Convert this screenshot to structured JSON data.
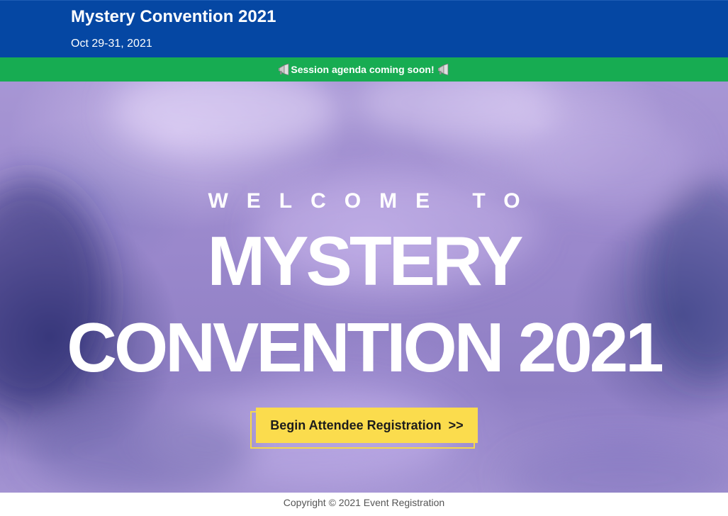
{
  "header": {
    "title": "Mystery Convention 2021",
    "dates": "Oct 29-31, 2021",
    "background_color": "#0547a3"
  },
  "banner": {
    "text": "Session agenda coming soon!",
    "icon": "megaphone-icon",
    "background_color": "#17ac52"
  },
  "hero": {
    "kicker": "WELCOME TO",
    "title_line_1": "MYSTERY",
    "title_line_2": "CONVENTION 2021",
    "cta_label": "Begin Attendee Registration",
    "cta_arrow": ">>",
    "cta_color": "#fbdc4d"
  },
  "footer": {
    "copyright": "Copyright © 2021 Event Registration"
  }
}
